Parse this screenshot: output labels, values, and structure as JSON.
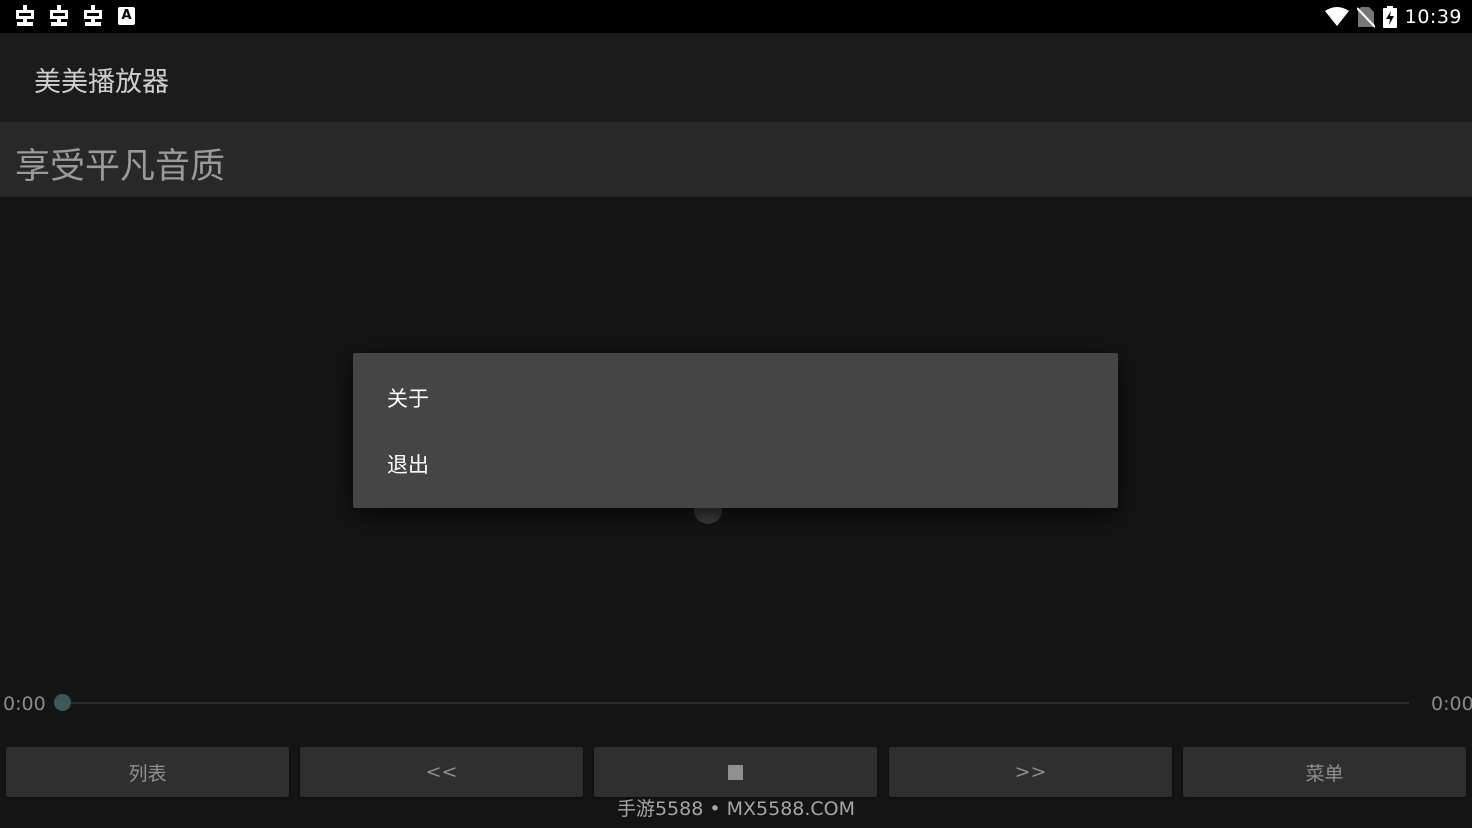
{
  "status_bar": {
    "time": "10:39",
    "left_icons": [
      "bug-icon",
      "bug-icon",
      "bug-icon",
      "a-keyboard-icon"
    ],
    "a_icon_letter": "A",
    "right_icons": [
      "wifi-icon",
      "no-sim-icon",
      "battery-charging-icon"
    ]
  },
  "app_bar": {
    "title": "美美播放器"
  },
  "banner": {
    "text": "享受平凡音质"
  },
  "player": {
    "elapsed": "0:00",
    "duration": "0:00",
    "progress": 0
  },
  "controls": {
    "list_label": "列表",
    "prev_label": "<<",
    "stop_icon": "stop-icon",
    "next_label": ">>",
    "menu_label": "菜单"
  },
  "menu": {
    "items": [
      {
        "label": "关于"
      },
      {
        "label": "退出"
      }
    ]
  },
  "watermark": "手游5588 • MX5588.COM",
  "colors": {
    "background": "#141414",
    "app_bar": "#1b1b1b",
    "banner": "#282828",
    "dialog": "#454545",
    "button": "#2f2f2f",
    "seek_thumb": "#3a5a5a"
  }
}
